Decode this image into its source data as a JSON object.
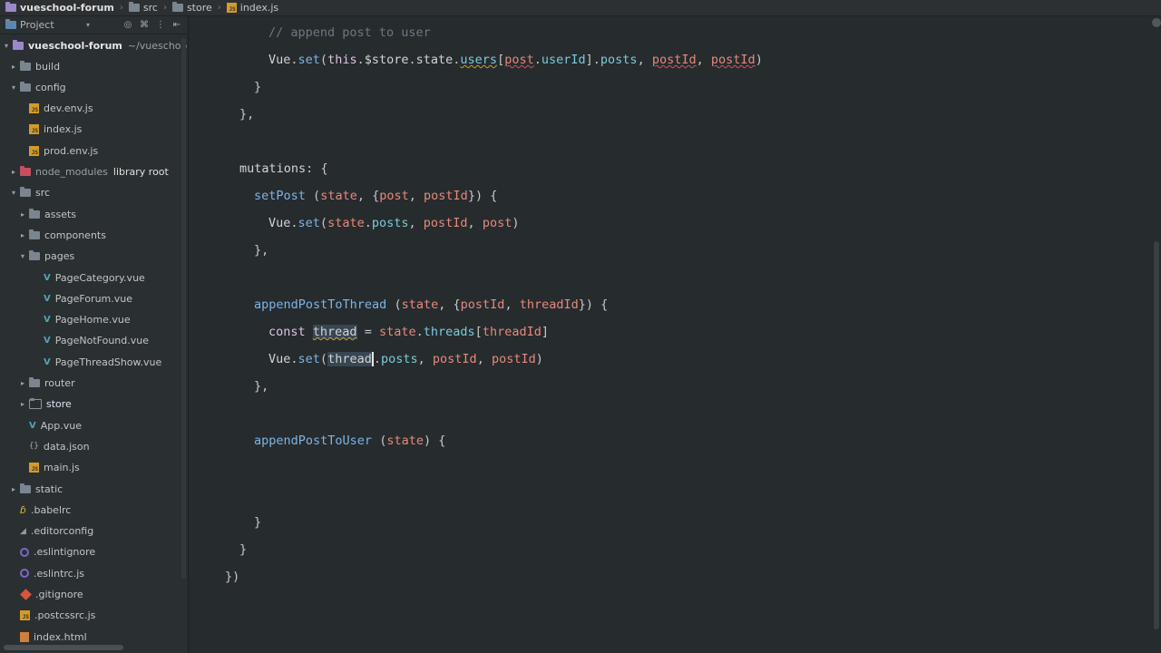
{
  "breadcrumb": {
    "project": "vueschool-forum",
    "items": [
      "src",
      "store",
      "index.js"
    ]
  },
  "sidebar": {
    "header_label": "Project",
    "root": {
      "name": "vueschool-forum",
      "path": "~/vueschool/v"
    },
    "library_root_label": "library root",
    "tree": [
      {
        "label": "build",
        "kind": "folder",
        "depth": 1,
        "arrow": "▸"
      },
      {
        "label": "config",
        "kind": "folder",
        "depth": 1,
        "arrow": "▾"
      },
      {
        "label": "dev.env.js",
        "kind": "js",
        "depth": 2
      },
      {
        "label": "index.js",
        "kind": "js",
        "depth": 2
      },
      {
        "label": "prod.env.js",
        "kind": "js",
        "depth": 2
      },
      {
        "label": "node_modules",
        "kind": "nm",
        "depth": 1,
        "arrow": "▸"
      },
      {
        "label": "src",
        "kind": "folder",
        "depth": 1,
        "arrow": "▾"
      },
      {
        "label": "assets",
        "kind": "folder",
        "depth": 2,
        "arrow": "▸"
      },
      {
        "label": "components",
        "kind": "folder",
        "depth": 2,
        "arrow": "▸"
      },
      {
        "label": "pages",
        "kind": "folder",
        "depth": 2,
        "arrow": "▾"
      },
      {
        "label": "PageCategory.vue",
        "kind": "vue",
        "depth": 3
      },
      {
        "label": "PageForum.vue",
        "kind": "vue",
        "depth": 3
      },
      {
        "label": "PageHome.vue",
        "kind": "vue",
        "depth": 3
      },
      {
        "label": "PageNotFound.vue",
        "kind": "vue",
        "depth": 3
      },
      {
        "label": "PageThreadShow.vue",
        "kind": "vue",
        "depth": 3
      },
      {
        "label": "router",
        "kind": "folder",
        "depth": 2,
        "arrow": "▸"
      },
      {
        "label": "store",
        "kind": "folder-open",
        "depth": 2,
        "arrow": "▸"
      },
      {
        "label": "App.vue",
        "kind": "vue",
        "depth": 2
      },
      {
        "label": "data.json",
        "kind": "json",
        "depth": 2
      },
      {
        "label": "main.js",
        "kind": "js",
        "depth": 2
      },
      {
        "label": "static",
        "kind": "folder",
        "depth": 1,
        "arrow": "▸"
      },
      {
        "label": ".babelrc",
        "kind": "babel",
        "depth": 1
      },
      {
        "label": ".editorconfig",
        "kind": "editorconfig",
        "depth": 1
      },
      {
        "label": ".eslintignore",
        "kind": "eslint",
        "depth": 1
      },
      {
        "label": ".eslintrc.js",
        "kind": "eslint",
        "depth": 1
      },
      {
        "label": ".gitignore",
        "kind": "git",
        "depth": 1
      },
      {
        "label": ".postcssrc.js",
        "kind": "js",
        "depth": 1
      },
      {
        "label": "index.html",
        "kind": "html",
        "depth": 1
      }
    ]
  },
  "code": {
    "lines": [
      "// append post to user",
      "Vue.set(this.$store.state.users[post.userId].posts, postId, postId)",
      "}",
      "},",
      "",
      "mutations: {",
      "setPost (state, {post, postId}) {",
      "Vue.set(state.posts, postId, post)",
      "},",
      "",
      "appendPostToThread (state, {postId, threadId}) {",
      "const thread = state.threads[threadId]",
      "Vue.set(thread.posts, postId, postId)",
      "},",
      "",
      "appendPostToUser (state) {",
      "",
      "",
      "}",
      "}",
      "})"
    ]
  }
}
